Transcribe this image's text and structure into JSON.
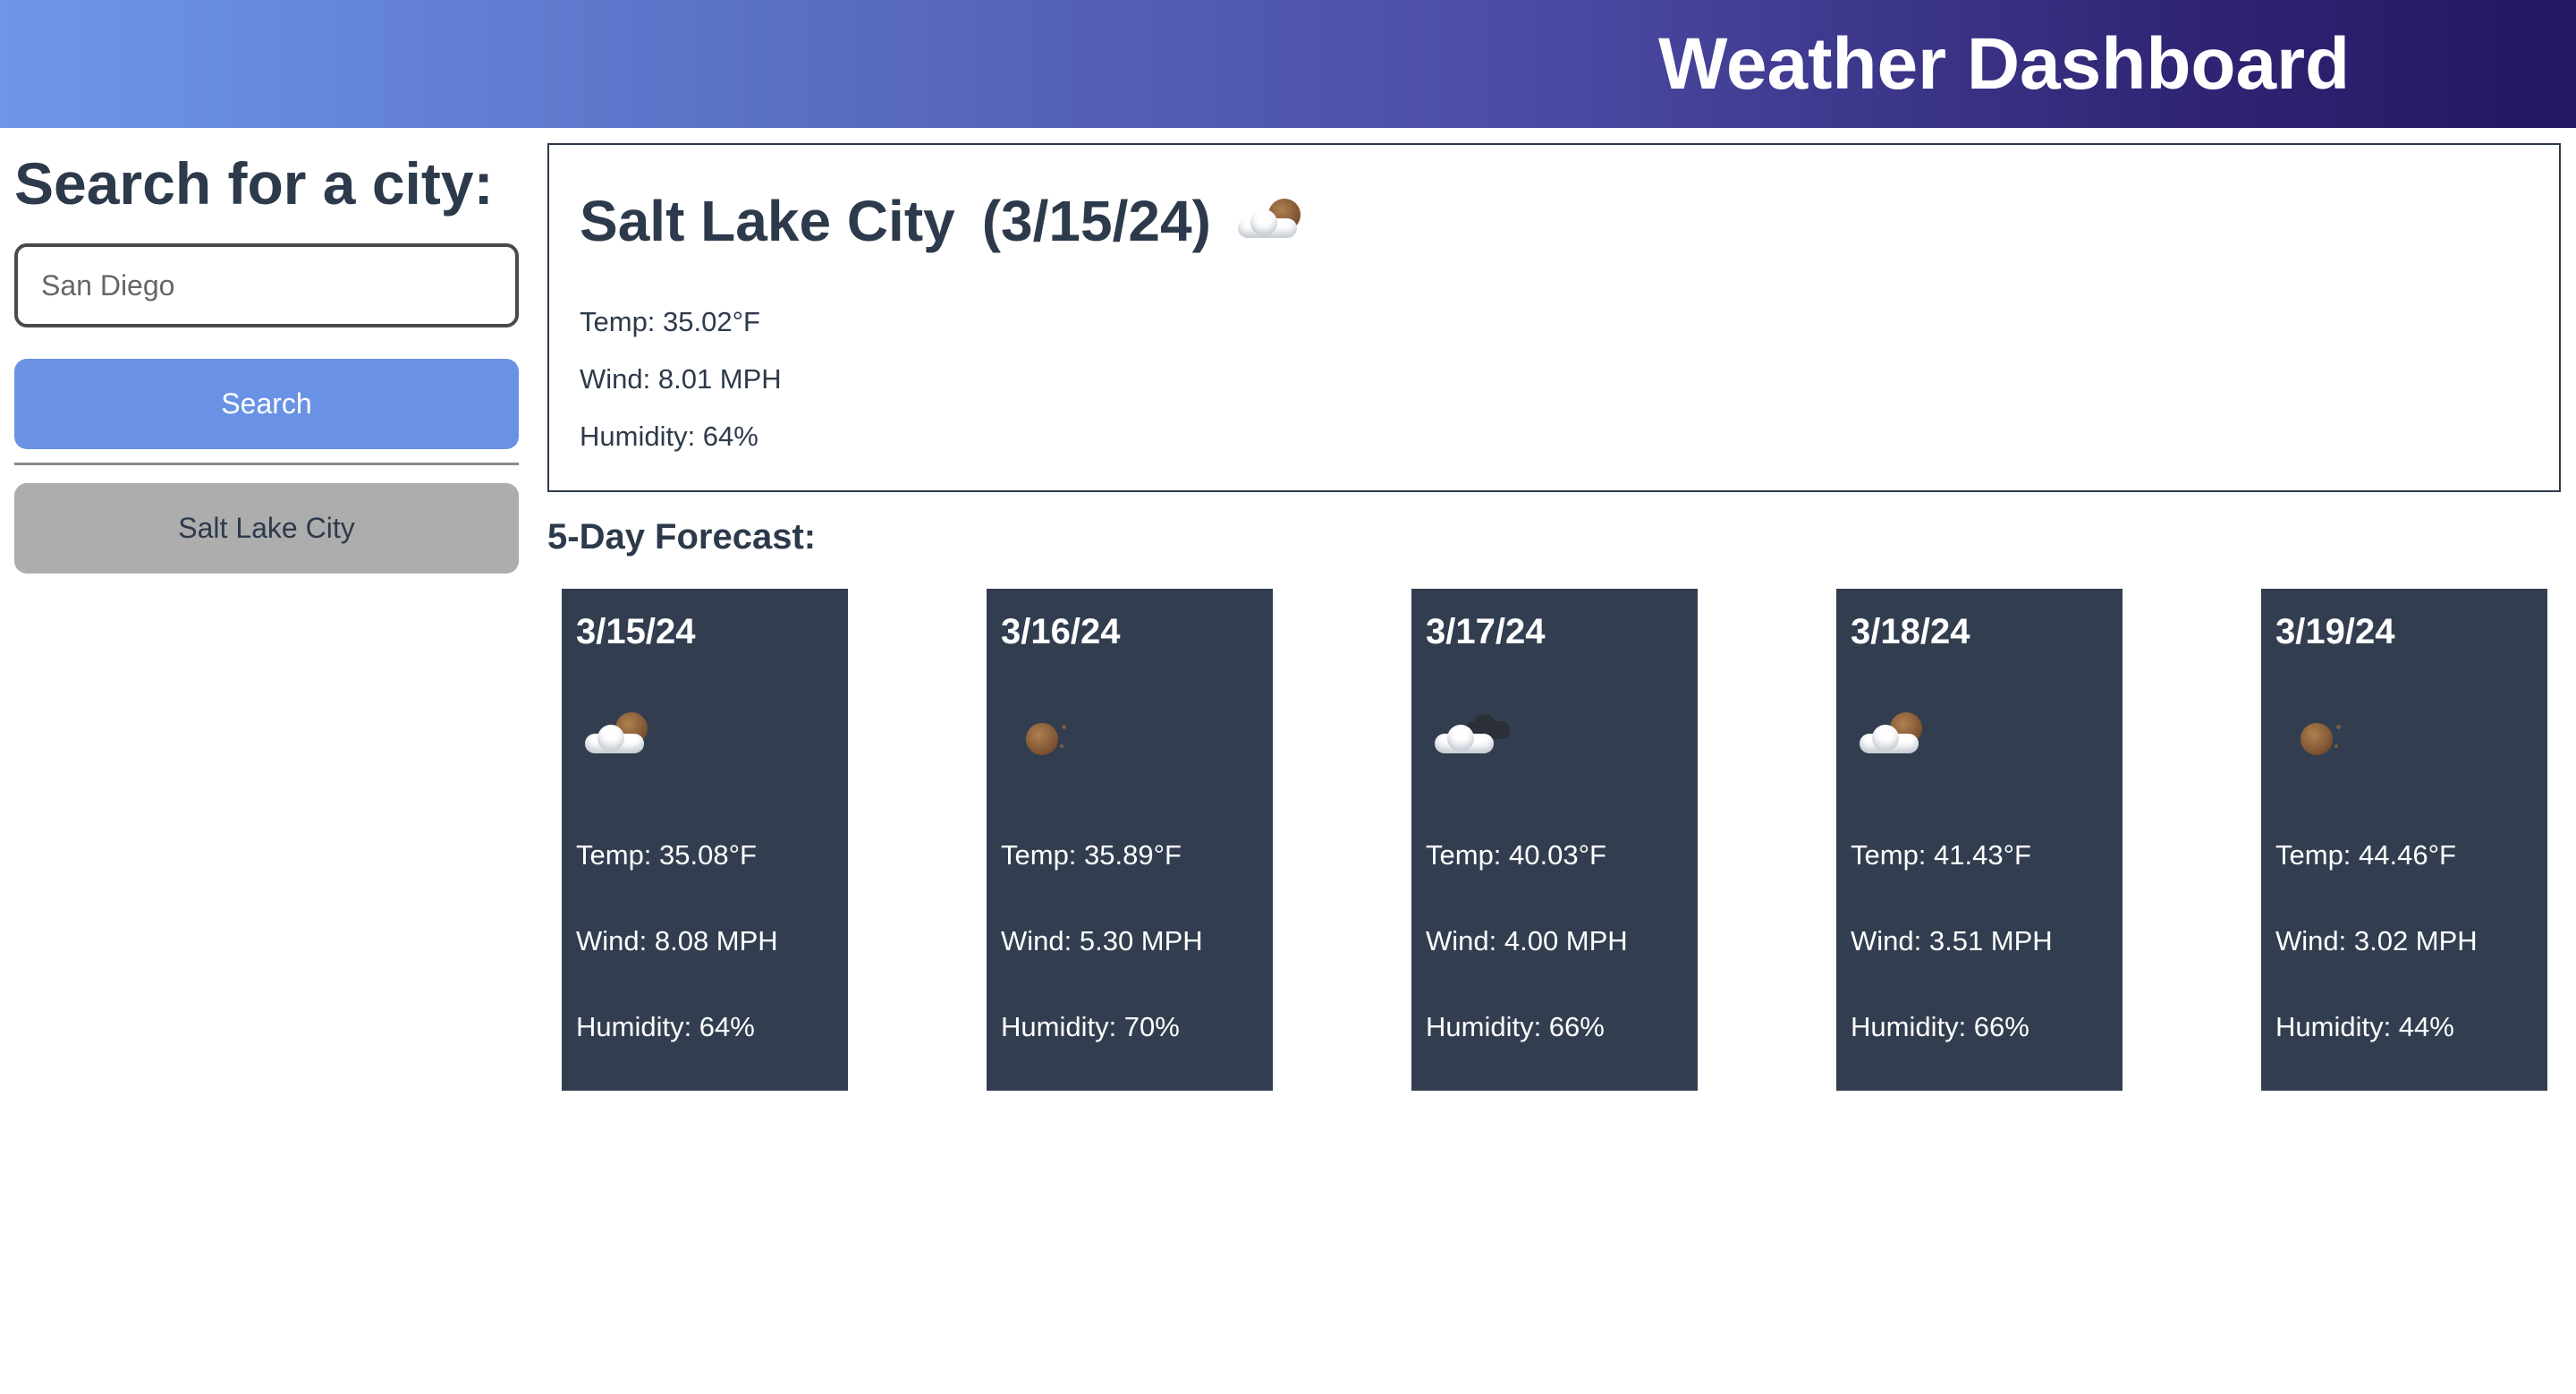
{
  "header": {
    "title": "Weather Dashboard"
  },
  "sidebar": {
    "heading": "Search for a city:",
    "search_input_value": "",
    "search_placeholder": "San Diego",
    "search_button_label": "Search",
    "history": [
      "Salt Lake City"
    ]
  },
  "current": {
    "city": "Salt Lake City",
    "date": "(3/15/24)",
    "icon": "partly-cloudy-icon",
    "temp": "Temp: 35.02°F",
    "wind": "Wind: 8.01 MPH",
    "humidity": "Humidity: 64%"
  },
  "forecast": {
    "heading": "5-Day Forecast:",
    "days": [
      {
        "date": "3/15/24",
        "icon": "partly-cloudy-icon",
        "temp": "Temp: 35.08°F",
        "wind": "Wind: 8.08 MPH",
        "humidity": "Humidity: 64%"
      },
      {
        "date": "3/16/24",
        "icon": "clear-sky-icon",
        "temp": "Temp: 35.89°F",
        "wind": "Wind: 5.30 MPH",
        "humidity": "Humidity: 70%"
      },
      {
        "date": "3/17/24",
        "icon": "broken-clouds-icon",
        "temp": "Temp: 40.03°F",
        "wind": "Wind: 4.00 MPH",
        "humidity": "Humidity: 66%"
      },
      {
        "date": "3/18/24",
        "icon": "partly-cloudy-icon",
        "temp": "Temp: 41.43°F",
        "wind": "Wind: 3.51 MPH",
        "humidity": "Humidity: 66%"
      },
      {
        "date": "3/19/24",
        "icon": "clear-sky-icon",
        "temp": "Temp: 44.46°F",
        "wind": "Wind: 3.02 MPH",
        "humidity": "Humidity: 44%"
      }
    ]
  },
  "colors": {
    "header_gradient_start": "#6e97e8",
    "header_gradient_end": "#241660",
    "search_button": "#6a92e4",
    "history_button": "#adadad",
    "card_background": "#323e50",
    "text_dark": "#2d3a4b"
  }
}
